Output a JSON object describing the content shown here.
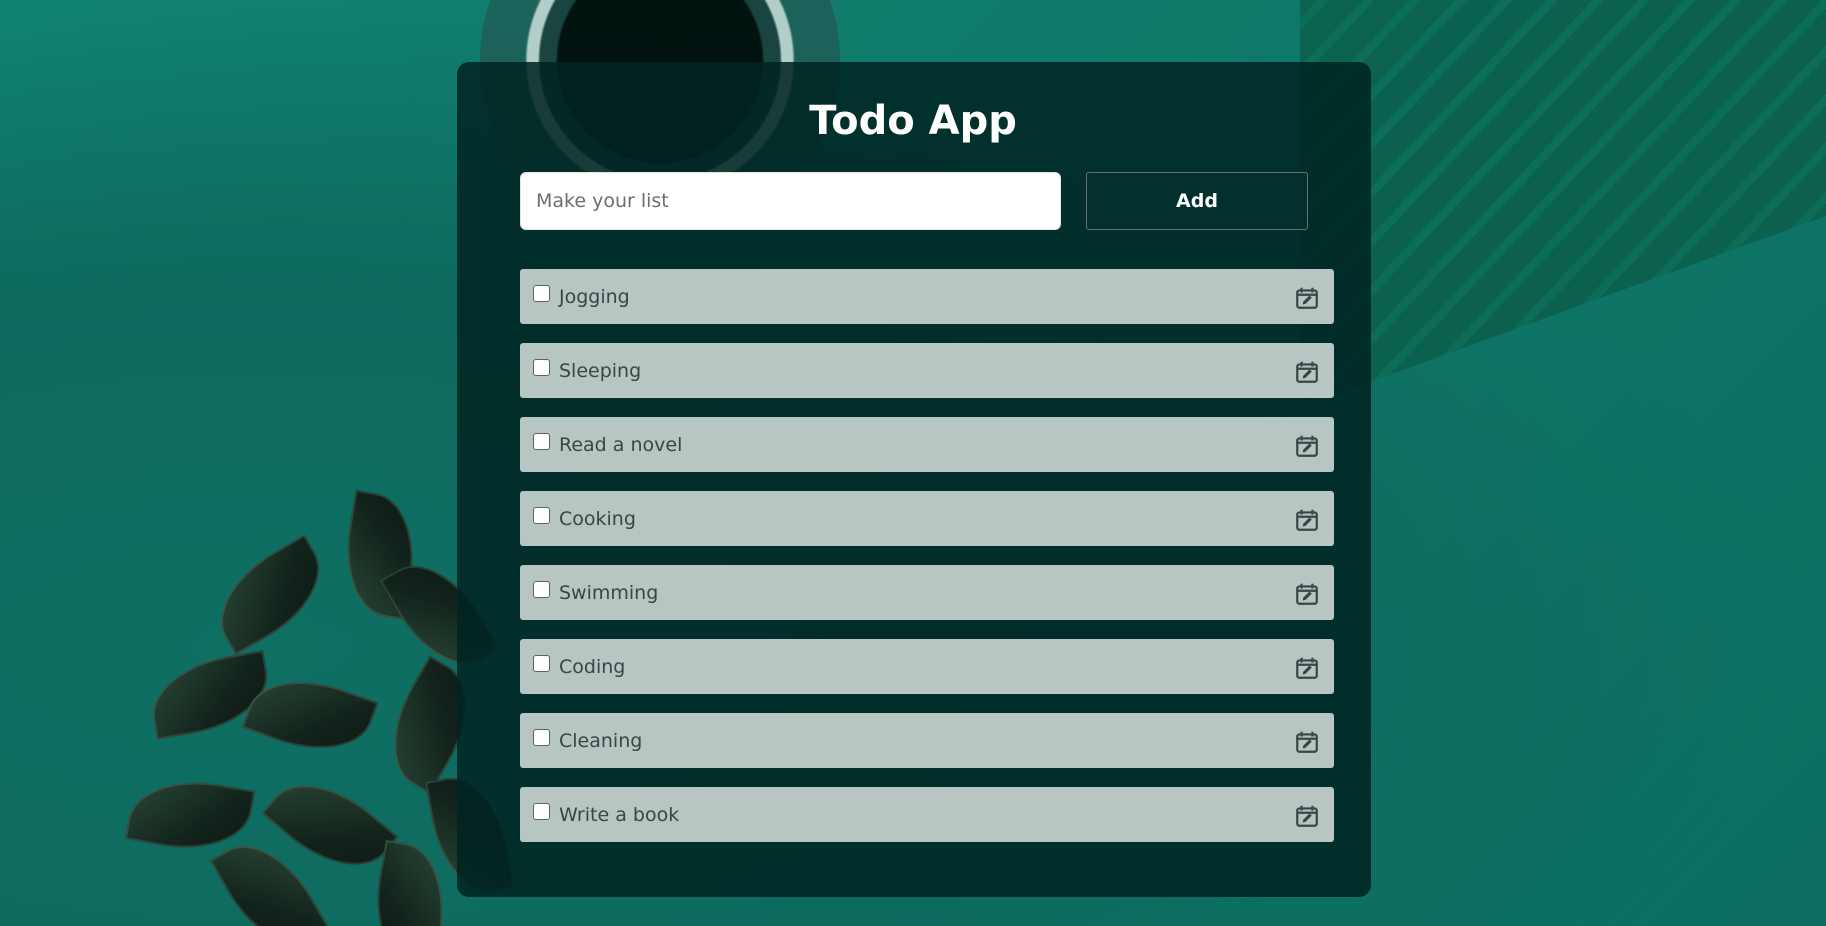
{
  "app": {
    "title": "Todo App"
  },
  "form": {
    "input_placeholder": "Make your list",
    "input_value": "",
    "add_label": "Add"
  },
  "todos": [
    {
      "label": "Jogging",
      "checked": false
    },
    {
      "label": "Sleeping",
      "checked": false
    },
    {
      "label": "Read a novel",
      "checked": false
    },
    {
      "label": "Cooking",
      "checked": false
    },
    {
      "label": "Swimming",
      "checked": false
    },
    {
      "label": "Coding",
      "checked": false
    },
    {
      "label": "Cleaning",
      "checked": false
    },
    {
      "label": "Write a book",
      "checked": false
    }
  ],
  "icons": {
    "item_action": "calendar-edit-icon"
  },
  "colors": {
    "panel": "#032a28",
    "item_bg": "#b7c5c3",
    "button_bg": "#03302d",
    "background": "#0f7a6b"
  }
}
